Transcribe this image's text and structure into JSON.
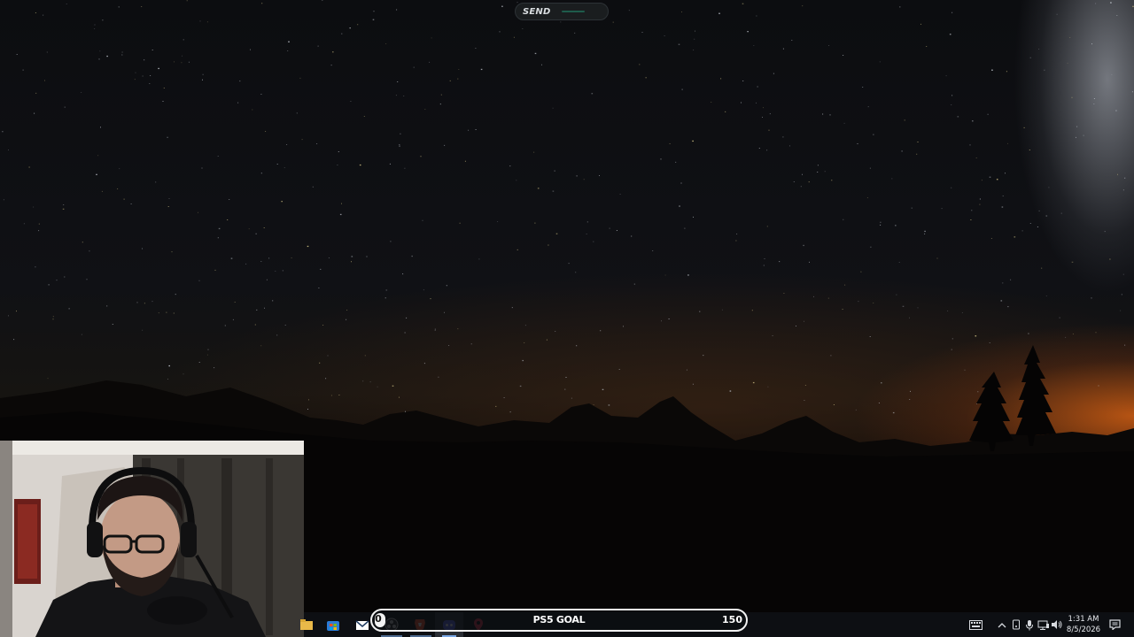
{
  "top_bar": {
    "send_label": "SEND"
  },
  "goal_widget": {
    "current": "0",
    "title": "PS5 GOAL",
    "target": "150",
    "progress_fraction": 0.0
  },
  "taskbar": {
    "pinned_apps": [
      {
        "icon": "file-explorer-icon"
      },
      {
        "icon": "microsoft-store-icon"
      },
      {
        "icon": "mail-icon"
      },
      {
        "icon": "obs-studio-icon"
      },
      {
        "icon": "brave-browser-icon"
      },
      {
        "icon": "discord-icon",
        "active": true
      },
      {
        "icon": "maps-pin-icon"
      }
    ]
  },
  "system_tray": {
    "icons": [
      "keyboard-layout-icon",
      "show-hidden-icons-chevron",
      "device-icon",
      "microphone-icon",
      "network-icon",
      "volume-icon"
    ],
    "time": "1:31 AM",
    "date": "8/5/2026",
    "notification_icon": "notification-center-icon"
  },
  "colors": {
    "taskbar_bg": "#0d0f13",
    "goal_border": "#f2f2f2",
    "sunset_glow": "#d25f14"
  }
}
